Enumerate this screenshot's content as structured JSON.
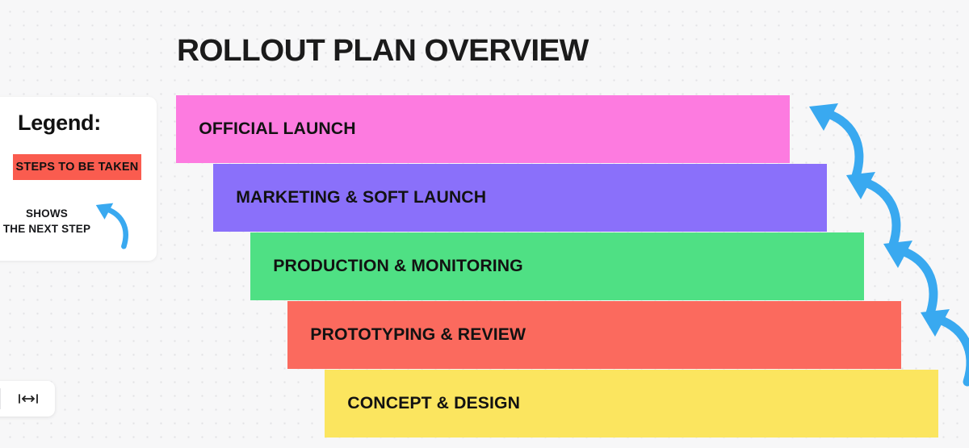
{
  "page": {
    "title": "ROLLOUT PLAN OVERVIEW",
    "background_color": "#f7f7f8",
    "dot_grid_color": "#e2e2e5"
  },
  "steps": [
    {
      "label": "OFFICIAL LAUNCH",
      "color": "#FD7BE0"
    },
    {
      "label": "MARKETING & SOFT LAUNCH",
      "color": "#8A70FA"
    },
    {
      "label": "PRODUCTION & MONITORING",
      "color": "#4FE084"
    },
    {
      "label": "PROTOTYPING & REVIEW",
      "color": "#FB6A5E"
    },
    {
      "label": "CONCEPT & DESIGN",
      "color": "#FBE55F"
    }
  ],
  "arrows": {
    "color": "#39A9F0",
    "icon": "curved-arrow-up-left-icon",
    "count": 4
  },
  "legend": {
    "title": "Legend:",
    "swatch": {
      "label": "STEPS TO BE TAKEN",
      "color": "#FA5C4F"
    },
    "arrow_note": {
      "line1": "SHOWS",
      "line2": "THE NEXT STEP",
      "arrow_color": "#39A9F0",
      "arrow_icon": "curved-arrow-up-left-icon"
    }
  },
  "toolbar": {
    "prev_icon": "chevron-left-icon",
    "width_icon": "horizontal-resize-icon",
    "width_label": "|↔|"
  }
}
